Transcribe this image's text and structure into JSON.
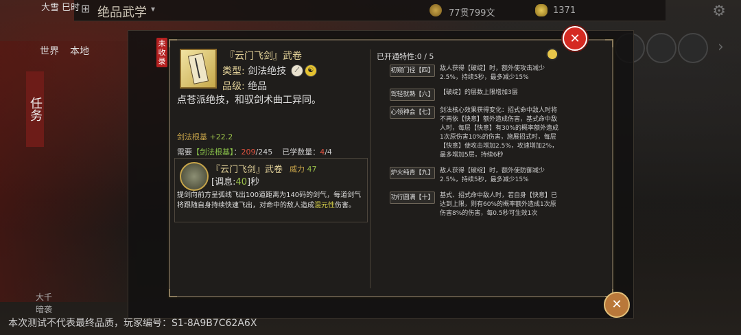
{
  "background": {
    "header_title": "绝品武学",
    "currency1": "77贯799文",
    "currency2": "1371",
    "left_top_text": "大雪 巳时",
    "world_label": "世界",
    "local_label": "本地",
    "task_label": "任务",
    "bottom_left_label": "大千",
    "bottom_left_label2": "暗袭",
    "footer": "本次测试不代表最终品质，玩家编号：S1-8A9B7C62A6X"
  },
  "modal": {
    "tag": "未收录",
    "book_name": "『云门飞剑』武卷",
    "type_label": "类型:",
    "type_value": "剑法绝技",
    "grade_label": "品级:",
    "grade_value": "绝品",
    "description": "点苍派绝技，和驭剑术曲工异同。",
    "attr_name": "剑法根基",
    "attr_value": "+22.2",
    "req_label": "需要",
    "req_attr": "【剑法根基】",
    "req_current": "209",
    "req_total": "/245",
    "learned_label": "已学数量：",
    "learned_current": "4",
    "learned_total": "/4",
    "skill": {
      "name": "『云门飞剑』武卷",
      "power_label": "威力",
      "power_value": "47",
      "cd_prefix": "[调息:",
      "cd_value": "40",
      "cd_suffix": "]秒",
      "desc_part1": "提剑向前方呈弧线飞出100道距离为140码的剑气，每道剑气将跟随自身持续快速飞出，对命中的敌人造成",
      "desc_highlight": "混元性",
      "desc_part2": "伤害。"
    },
    "traits_header": "已开通特性:0 / 5",
    "traits": [
      {
        "name": "初窥门径【四】",
        "desc": "敌人获得【破绽】时，额外使攻击减少2.5%，持续5秒，最多减少15%"
      },
      {
        "name": "驾轻就熟【六】",
        "desc": "【破绽】的层数上限增加3层"
      },
      {
        "name": "心领神会【七】",
        "desc": "剑法核心效果获得变化：招式命中敌人时将不再依【快意】额外造成伤害，基式命中敌人时，每层【快意】有30%的概率额外造成1次原伤害10%的伤害，施展招式时，每层【快意】使攻击增加2.5%，攻速增加2%，最多增加5层，持续6秒"
      },
      {
        "name": "炉火纯青【九】",
        "desc": "敌人获得【破绽】时，额外使防御减少2.5%，持续5秒，最多减少15%"
      },
      {
        "name": "功行圆满【十】",
        "desc": "基式、招式命中敌人时，若自身【快意】已达到上限，则有60%的概率额外造成1次原伤害8%的伤害，每0.5秒可生效1次"
      }
    ]
  },
  "colors": {
    "gold_text": "#e4d39a",
    "green_value": "#9ac04a",
    "red_value": "#e0523e",
    "close_red": "#d52a22"
  }
}
